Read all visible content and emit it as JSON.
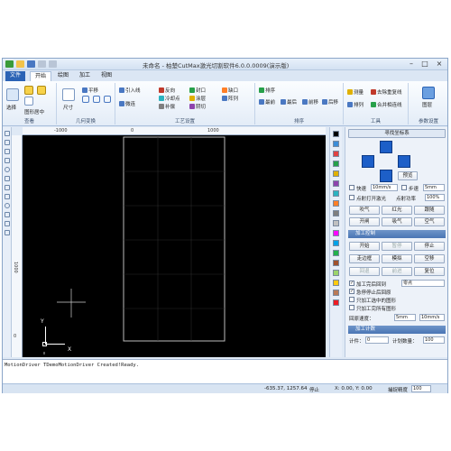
{
  "app": {
    "title": "未命名 - 柏楚CutMax激光切割软件6.0.0.0009(演示版)",
    "minimize": "–",
    "maximize": "□",
    "close": "×"
  },
  "tabs": [
    {
      "label": "文件"
    },
    {
      "label": "开始"
    },
    {
      "label": "绘图"
    },
    {
      "label": "加工"
    },
    {
      "label": "视图"
    }
  ],
  "ribbon": {
    "view_group": {
      "title": "查看",
      "select": "选择",
      "fit": "图形居中"
    },
    "geometry_group": {
      "title": "几何变换",
      "size": "尺寸",
      "flip_h": "平移"
    },
    "process_group": {
      "title": "工艺设置",
      "lead": "引入线",
      "reverse": "反向",
      "cool": "冷却点",
      "microjoint": "微连",
      "seal": "封口",
      "compensation": "补偿",
      "coating": "涂层",
      "outside": "阴切",
      "gap": "缺口",
      "array": "阵列"
    },
    "sort_group": {
      "title": "排序",
      "sort": "排序",
      "order1": "最前",
      "order2": "最后",
      "order3": "前移",
      "order4": "后移"
    },
    "tools_group": {
      "title": "工具",
      "measure": "测量",
      "arrange": "排列",
      "join": "合并相连线",
      "remove_dup": "去除重复线"
    },
    "params_group": {
      "title": "参数设置",
      "layers": "图层"
    }
  },
  "ruler": {
    "h1": "-1000",
    "h2": "0",
    "h3": "1000",
    "v1": "1000",
    "v2": "0"
  },
  "canvas": {
    "axis_y": "Y",
    "axis_x": "X"
  },
  "palette": [
    "#000000",
    "#3c8dd8",
    "#e04343",
    "#27a04a",
    "#e0b000",
    "#8e44ad",
    "#2bb3c0",
    "#ff7f27",
    "#7f7f7f",
    "#c0c0c0",
    "#ff00ff",
    "#00a2e8",
    "#22b14c",
    "#a0522d",
    "#9cd36b",
    "#ffc90e",
    "#b97a57",
    "#ed1c24"
  ],
  "panel": {
    "header": "寻找坐标系",
    "preview": "预览",
    "fast": "快速",
    "fast_val": "10mm/s",
    "step": "步速",
    "step_val": "5mm",
    "laser_point": "点射打开激光",
    "point_power": "点射功率",
    "point_power_val": "100%",
    "btn_blow": "吹气",
    "btn_red": "红光",
    "btn_follow": "跟随",
    "btn_shutter": "开闸",
    "btn_suck": "吸气",
    "btn_air": "空气",
    "control_title": "加工控制",
    "start": "开始",
    "pause": "暂停",
    "stop": "停止",
    "go_zero": "走边框",
    "simulate": "模拟",
    "empty_run": "空移",
    "back": "回退",
    "forward": "前进",
    "reset": "复位",
    "opt1": "加工完后回到",
    "opt1_val": "零点",
    "opt2": "急停停止后回原",
    "opt3": "只加工选中的图形",
    "opt4": "只加工完所有图形",
    "return_label": "回原速度：",
    "return_val": "5mm",
    "speed_val": "10mm/s",
    "count_title": "加工计数",
    "count_label": "计件：",
    "count_val": "0",
    "plan_label": "计划数量：",
    "plan_val": "100"
  },
  "log": {
    "line": "MotionDriver TDemoMotionDriver Created!Ready."
  },
  "status": {
    "coords": "-635.37, 1257.64",
    "state": "停止",
    "xy": "X: 0.00, Y: 0.00",
    "snap_label": "捕捉精度",
    "snap_val": "100"
  }
}
